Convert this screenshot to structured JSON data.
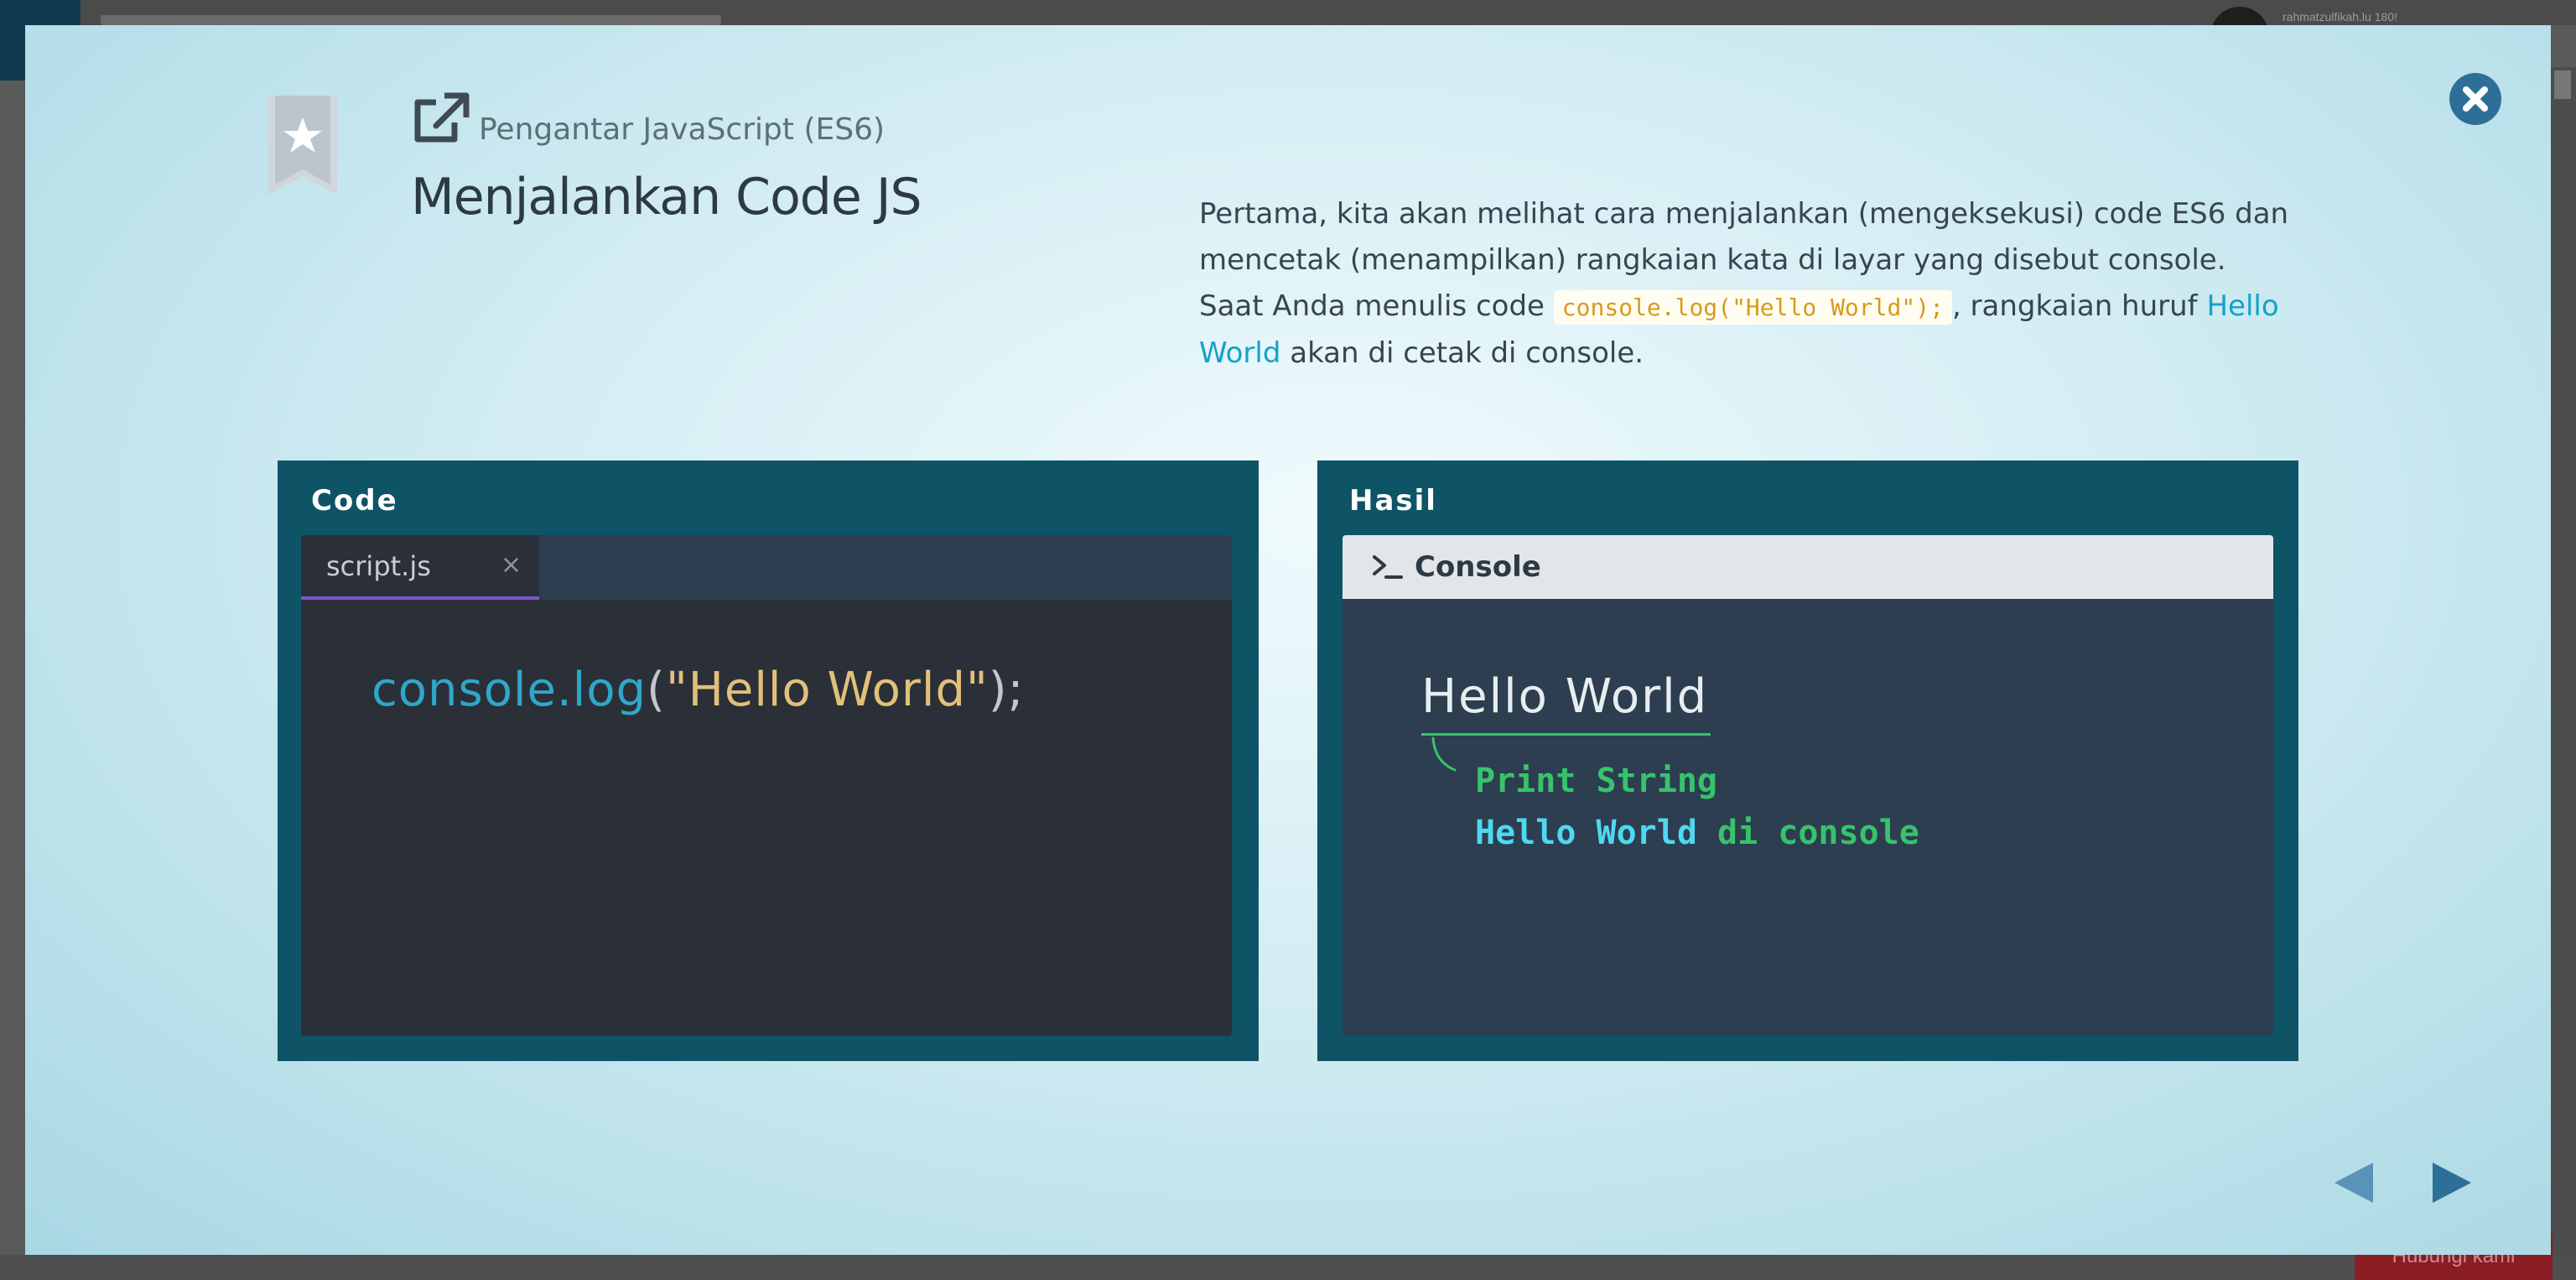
{
  "background": {
    "username": "rahmatzulfikah.lu 180!",
    "action_button": "Hubungi kami"
  },
  "modal": {
    "course_title": "Pengantar JavaScript (ES6)",
    "lesson_title": "Menjalankan Code JS",
    "description": {
      "part1": "Pertama, kita akan melihat cara menjalankan (mengeksekusi) code ES6 dan mencetak (menampilkan) rangkaian kata di layar yang disebut console. Saat Anda menulis code ",
      "code": "console.log(\"Hello World\");",
      "part2": ", rangkaian huruf ",
      "highlight": "Hello World",
      "part3": " akan di cetak di console."
    },
    "code_panel": {
      "label": "Code",
      "tab_name": "script.js",
      "tab_close": "×",
      "code": {
        "fn": "console.log",
        "open": "(",
        "str": "\"Hello World\"",
        "close": ");"
      }
    },
    "result_panel": {
      "label": "Hasil",
      "console_title": "Console",
      "output": "Hello World",
      "annotation_line1": "Print String",
      "annotation_line2a": "Hello World",
      "annotation_line2b": " di console"
    },
    "icons": {
      "bookmark": "bookmark-star-icon",
      "external": "external-link-icon",
      "close": "close-icon",
      "prev": "prev-arrow-icon",
      "next": "next-arrow-icon"
    },
    "colors": {
      "accent": "#2d6f96",
      "panel": "#0e5466",
      "tab_underline": "#7b58c6",
      "highlight": "#14a2c9",
      "code_inline": "#d79a1e",
      "annotation_green": "#37c36c",
      "annotation_cyan": "#4fd8f2"
    }
  }
}
